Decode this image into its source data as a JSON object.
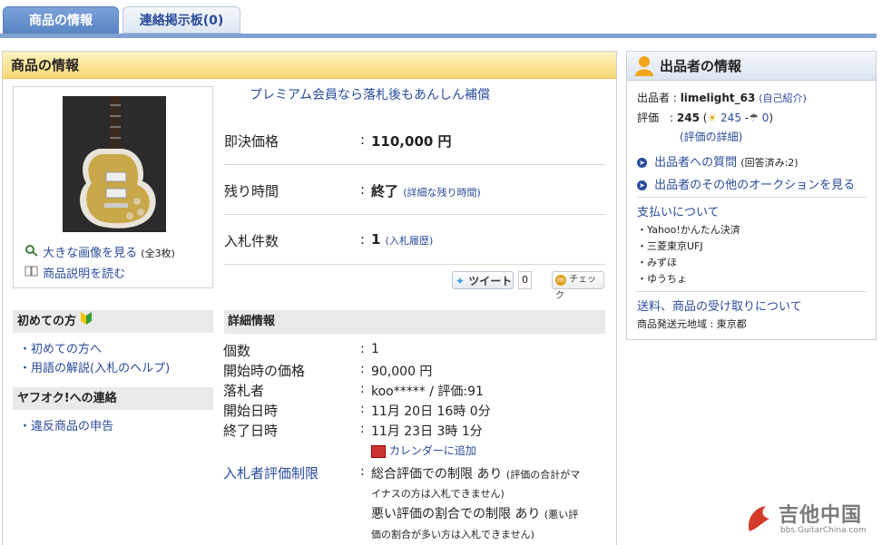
{
  "tabs": [
    {
      "label": "商品の情報"
    },
    {
      "label": "連絡掲示板(0)"
    }
  ],
  "item_section": {
    "title": "商品の情報",
    "links": {
      "large_image": "大きな画像を見る",
      "large_image_count": "(全3枚)",
      "read_desc": "商品説明を読む"
    },
    "premium": "プレミアム会員なら落札後もあんしん補償",
    "prices": [
      {
        "label": "即決価格",
        "value": "110,000 円",
        "sub": ""
      },
      {
        "label": "残り時間",
        "value": "終了",
        "sub": "(詳細な残り時間)"
      },
      {
        "label": "入札件数",
        "value": "1",
        "sub": "(入札履歴)"
      }
    ],
    "tweet_label": "ツイート",
    "tweet_count": "0",
    "check_label": "チェック"
  },
  "sidebar": {
    "first_time_title": "初めての方",
    "first_time_links": [
      "初めての方へ",
      "用語の解説(入札のヘルプ)"
    ],
    "contact_title": "ヤフオク!への連絡",
    "contact_links": [
      "違反商品の申告"
    ]
  },
  "details": {
    "title": "詳細情報",
    "rows": [
      {
        "label": "個数",
        "value": "1"
      },
      {
        "label": "開始時の価格",
        "value": "90,000 円"
      },
      {
        "label": "落札者",
        "value": "koo***** / 評価:91"
      },
      {
        "label": "開始日時",
        "value": "11月 20日 16時 0分"
      },
      {
        "label": "終了日時",
        "value": "11月 23日 3時 1分"
      }
    ],
    "calendar_link": "カレンダーに追加",
    "restriction_label": "入札者評価制限",
    "restriction_1": "総合評価での制限 あり",
    "restriction_1_note_a": "(評価の合計がマ",
    "restriction_1_note_b": "イナスの方は入札できません)",
    "restriction_2": "悪い評価の割合での制限 あり",
    "restriction_2_note_a": "(悪い評",
    "restriction_2_note_b": "価の割合が多い方は入札できません)"
  },
  "seller": {
    "title": "出品者の情報",
    "seller_label": "出品者 :",
    "seller_name": "limelight_63",
    "self_intro": "(自己紹介)",
    "rating_label": "評価　:",
    "rating_value": "245",
    "rating_good": "245",
    "rating_bad": "0",
    "rating_detail": "(評価の詳細)",
    "question_link": "出品者への質問",
    "question_count": "(回答済み:2)",
    "other_auctions": "出品者のその他のオークションを見る",
    "payment_title": "支払いについて",
    "payment_methods": [
      "Yahoo!かんたん決済",
      "三菱東京UFJ",
      "みずほ",
      "ゆうちょ"
    ],
    "shipping_title": "送料、商品の受け取りについて",
    "ship_from_label": "商品発送元地域 :",
    "ship_from_value": "東京都"
  },
  "watermark": {
    "main": "吉他中国",
    "sub": "bbs.GuitarChina.com"
  }
}
